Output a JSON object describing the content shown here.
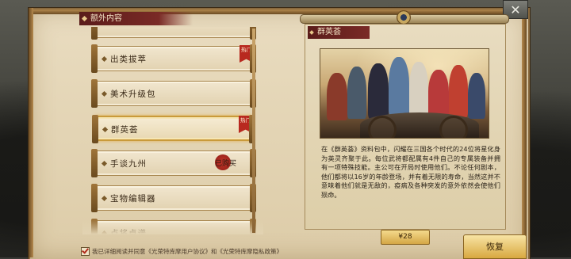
{
  "section_header": "额外内容",
  "close_label": "✕",
  "list": {
    "items": [
      {
        "label": "",
        "hot": false,
        "selected": false,
        "owned": false
      },
      {
        "label": "出类拔萃",
        "hot": true,
        "hot_label": "热门",
        "selected": false,
        "owned": false
      },
      {
        "label": "美术升级包",
        "hot": false,
        "selected": false,
        "owned": false
      },
      {
        "label": "群英荟",
        "hot": true,
        "hot_label": "热门",
        "selected": true,
        "owned": false
      },
      {
        "label": "手谈九州",
        "hot": false,
        "selected": false,
        "owned": true,
        "owned_label": "已购买"
      },
      {
        "label": "宝物编辑器",
        "hot": false,
        "selected": false,
        "owned": false
      },
      {
        "label": "点将卓谱",
        "hot": false,
        "selected": false,
        "owned": false
      }
    ]
  },
  "detail": {
    "title": "群英荟",
    "description": "在《群英荟》资料包中，闪耀在三国各个时代的24位将星化身为英灵齐聚于此。每位武将都配属有4件自己的专属装备并拥有一项特殊技能。主公可在开局时使用他们。不论任何剧本，他们都将以16岁的年龄登场，并有着无限的寿命，当然这并不意味着他们就是无敌的，疫病及各种突发的意外依然会使他们殒命。",
    "price": "¥28",
    "restore_label": "恢复"
  },
  "footer": {
    "text": "我已详细阅读并同意《光荣特库摩用户协议》和《光荣特库摩隐私政策》",
    "checked": true
  }
}
